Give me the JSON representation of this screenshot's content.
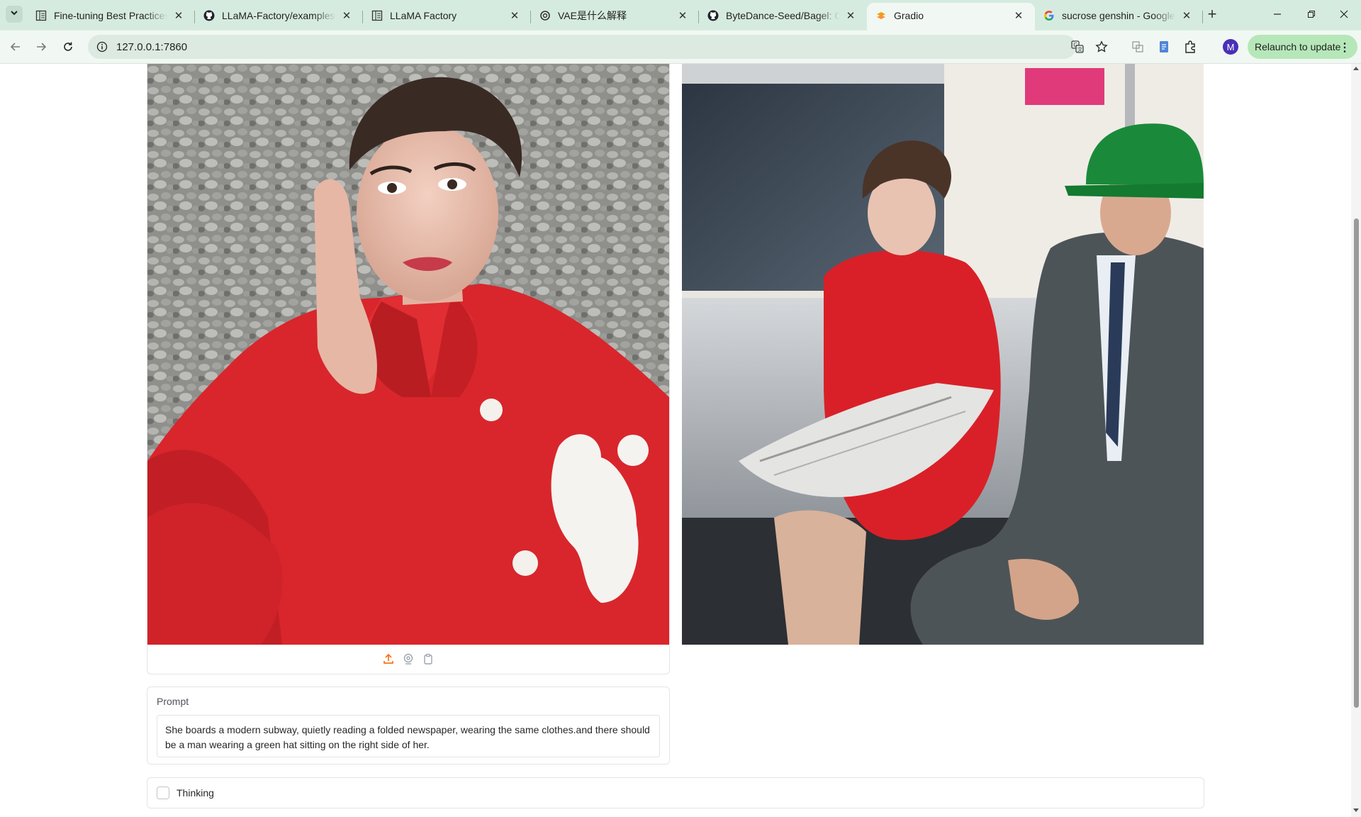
{
  "browser": {
    "tabs": [
      {
        "title": "Fine-tuning Best Practices -",
        "icon": "doc-icon",
        "active": false
      },
      {
        "title": "LLaMA-Factory/examples at",
        "icon": "github-icon",
        "active": false
      },
      {
        "title": "LLaMA Factory",
        "icon": "doc-icon",
        "active": false
      },
      {
        "title": "VAE是什么解释",
        "icon": "openai-icon",
        "active": false
      },
      {
        "title": "ByteDance-Seed/Bagel: Op",
        "icon": "github-icon",
        "active": false
      },
      {
        "title": "Gradio",
        "icon": "gradio-icon",
        "active": true
      },
      {
        "title": "sucrose genshin - Google S",
        "icon": "google-icon",
        "active": false
      }
    ],
    "url": "127.0.0.1:7860",
    "avatar_letter": "M",
    "relaunch_label": "Relaunch to update",
    "accent": "#b6e7b9"
  },
  "app": {
    "input_image": {
      "description_icon": "portrait-image",
      "tools": [
        "upload-icon",
        "webcam-icon",
        "clipboard-icon"
      ]
    },
    "output_image": {
      "description_icon": "subway-image"
    },
    "prompt": {
      "label": "Prompt",
      "value": "She boards a modern subway, quietly reading a folded newspaper, wearing the same clothes.and there should be a man wearing a green hat sitting on the right side of her."
    },
    "thinking": {
      "label": "Thinking",
      "checked": false
    }
  }
}
